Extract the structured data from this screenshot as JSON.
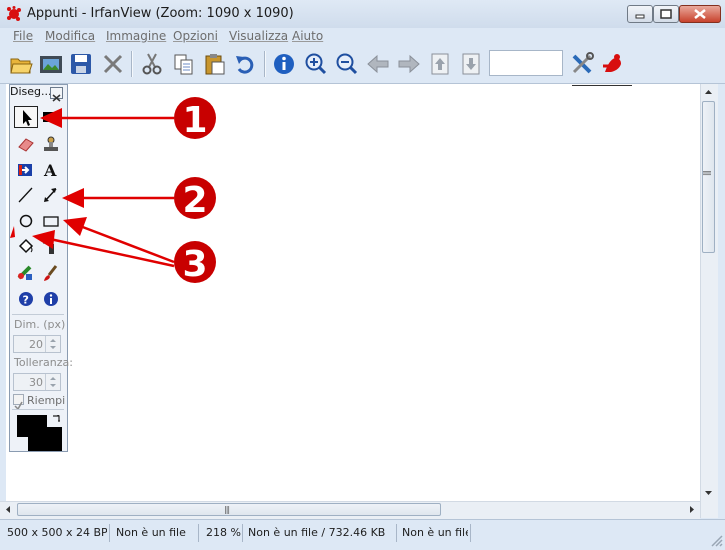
{
  "window": {
    "title": "Appunti - IrfanView (Zoom: 1090 x 1090)",
    "controls": [
      "minimize",
      "maximize",
      "close"
    ]
  },
  "menu": [
    "File",
    "Modifica",
    "Immagine",
    "Opzioni",
    "Visualizza",
    "Aiuto"
  ],
  "toolbar": {
    "buttons": [
      "open-icon",
      "slideshow-icon",
      "save-icon",
      "delete-icon",
      "cut-icon",
      "copy-icon",
      "paste-icon",
      "undo-icon",
      "info-icon",
      "zoom-in-icon",
      "zoom-out-icon",
      "prev-icon",
      "next-icon",
      "prev-page-icon",
      "next-page-icon",
      "settings-icon",
      "irfanview-icon"
    ],
    "page_input": ""
  },
  "paint_palette": {
    "title": "Diseg...",
    "tools": [
      "select-arrow",
      "selection-rect",
      "eraser",
      "clone-stamp",
      "arrow-box",
      "text",
      "line",
      "double-arrow",
      "circle",
      "rectangle",
      "fill-bucket",
      "spray",
      "color-replace",
      "brush",
      "help",
      "info"
    ],
    "dim_label": "Dim. (px)",
    "dim_value": "20",
    "tolerance_label": "Tolleranza:",
    "tolerance_value": "30",
    "fill_label": "Riempi",
    "fill_checked": true,
    "foreground_color": "#000000",
    "background_color": "#000000"
  },
  "annotations": [
    "1",
    "2",
    "3"
  ],
  "annotation_color": "#e00000",
  "status": [
    "500 x 500 x 24 BPP",
    "Non è un file",
    "218 %",
    "Non è un file / 732.46 KB",
    "Non è un file"
  ]
}
